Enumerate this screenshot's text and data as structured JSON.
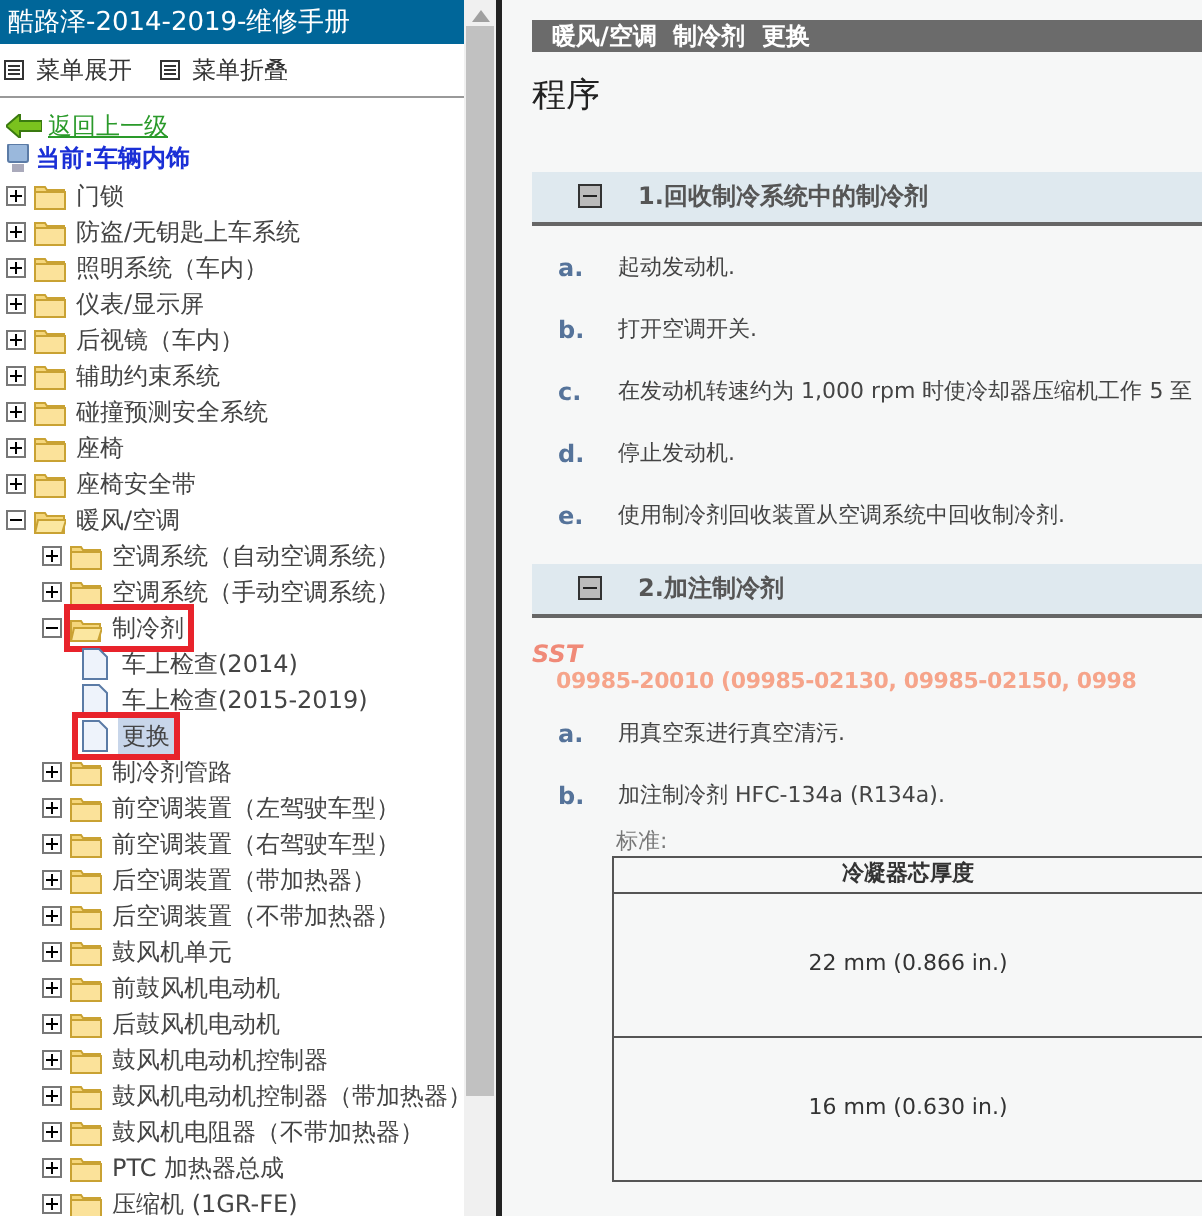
{
  "sidebar": {
    "title": "酷路泽-2014-2019-维修手册",
    "menu": [
      {
        "label": "菜单展开"
      },
      {
        "label": "菜单折叠"
      }
    ],
    "back_link": "返回上一级",
    "current": "当前:车辆内饰",
    "tree": [
      {
        "label": "门锁",
        "kind": "folder",
        "expanded": false,
        "selected": false,
        "highlighted": false
      },
      {
        "label": "防盗/无钥匙上车系统",
        "kind": "folder",
        "expanded": false,
        "selected": false,
        "highlighted": false
      },
      {
        "label": "照明系统（车内）",
        "kind": "folder",
        "expanded": false,
        "selected": false,
        "highlighted": false
      },
      {
        "label": "仪表/显示屏",
        "kind": "folder",
        "expanded": false,
        "selected": false,
        "highlighted": false
      },
      {
        "label": "后视镜（车内）",
        "kind": "folder",
        "expanded": false,
        "selected": false,
        "highlighted": false
      },
      {
        "label": "辅助约束系统",
        "kind": "folder",
        "expanded": false,
        "selected": false,
        "highlighted": false
      },
      {
        "label": "碰撞预测安全系统",
        "kind": "folder",
        "expanded": false,
        "selected": false,
        "highlighted": false
      },
      {
        "label": "座椅",
        "kind": "folder",
        "expanded": false,
        "selected": false,
        "highlighted": false
      },
      {
        "label": "座椅安全带",
        "kind": "folder",
        "expanded": false,
        "selected": false,
        "highlighted": false
      },
      {
        "label": "暖风/空调",
        "kind": "folder",
        "expanded": true,
        "selected": false,
        "highlighted": false,
        "children": [
          {
            "label": "空调系统（自动空调系统）",
            "kind": "folder",
            "expanded": false,
            "selected": false,
            "highlighted": false
          },
          {
            "label": "空调系统（手动空调系统）",
            "kind": "folder",
            "expanded": false,
            "selected": false,
            "highlighted": false
          },
          {
            "label": "制冷剂",
            "kind": "folder",
            "expanded": true,
            "selected": false,
            "highlighted": true,
            "children": [
              {
                "label": "车上检查(2014)",
                "kind": "doc",
                "selected": false,
                "highlighted": false
              },
              {
                "label": "车上检查(2015-2019)",
                "kind": "doc",
                "selected": false,
                "highlighted": false
              },
              {
                "label": "更换",
                "kind": "doc",
                "selected": true,
                "highlighted": true
              }
            ]
          },
          {
            "label": "制冷剂管路",
            "kind": "folder",
            "expanded": false,
            "selected": false,
            "highlighted": false
          },
          {
            "label": "前空调装置（左驾驶车型）",
            "kind": "folder",
            "expanded": false,
            "selected": false,
            "highlighted": false
          },
          {
            "label": "前空调装置（右驾驶车型）",
            "kind": "folder",
            "expanded": false,
            "selected": false,
            "highlighted": false
          },
          {
            "label": "后空调装置（带加热器）",
            "kind": "folder",
            "expanded": false,
            "selected": false,
            "highlighted": false
          },
          {
            "label": "后空调装置（不带加热器）",
            "kind": "folder",
            "expanded": false,
            "selected": false,
            "highlighted": false
          },
          {
            "label": "鼓风机单元",
            "kind": "folder",
            "expanded": false,
            "selected": false,
            "highlighted": false
          },
          {
            "label": "前鼓风机电动机",
            "kind": "folder",
            "expanded": false,
            "selected": false,
            "highlighted": false
          },
          {
            "label": "后鼓风机电动机",
            "kind": "folder",
            "expanded": false,
            "selected": false,
            "highlighted": false
          },
          {
            "label": "鼓风机电动机控制器",
            "kind": "folder",
            "expanded": false,
            "selected": false,
            "highlighted": false
          },
          {
            "label": "鼓风机电动机控制器（带加热器）",
            "kind": "folder",
            "expanded": false,
            "selected": false,
            "highlighted": false
          },
          {
            "label": "鼓风机电阻器（不带加热器）",
            "kind": "folder",
            "expanded": false,
            "selected": false,
            "highlighted": false
          },
          {
            "label": "PTC 加热器总成",
            "kind": "folder",
            "expanded": false,
            "selected": false,
            "highlighted": false
          },
          {
            "label": "压缩机 (1GR-FE)",
            "kind": "folder",
            "expanded": false,
            "selected": false,
            "highlighted": false
          }
        ]
      }
    ]
  },
  "content": {
    "breadcrumb": "暖风/空调  制冷剂  更换",
    "heading": "程序",
    "sections": [
      {
        "title": "1.回收制冷系统中的制冷剂",
        "expanded": true,
        "steps": [
          {
            "letter": "a.",
            "text": "起动发动机."
          },
          {
            "letter": "b.",
            "text": "打开空调开关."
          },
          {
            "letter": "c.",
            "text": "在发动机转速约为 1,000 rpm 时使冷却器压缩机工作 5 至"
          },
          {
            "letter": "d.",
            "text": "停止发动机."
          },
          {
            "letter": "e.",
            "text": "使用制冷剂回收装置从空调系统中回收制冷剂."
          }
        ]
      },
      {
        "title": "2.加注制冷剂",
        "expanded": true,
        "sst": {
          "label": "SST",
          "text": "09985-20010  (09985-02130, 09985-02150, 0998"
        },
        "steps": [
          {
            "letter": "a.",
            "text": "用真空泵进行真空清污."
          },
          {
            "letter": "b.",
            "text": "加注制冷剂 HFC-134a (R134a)."
          }
        ],
        "spec": {
          "label": "标准:",
          "header": "冷凝器芯厚度",
          "rows": [
            "22 mm (0.866 in.)",
            "16 mm (0.630 in.)"
          ]
        }
      }
    ]
  }
}
